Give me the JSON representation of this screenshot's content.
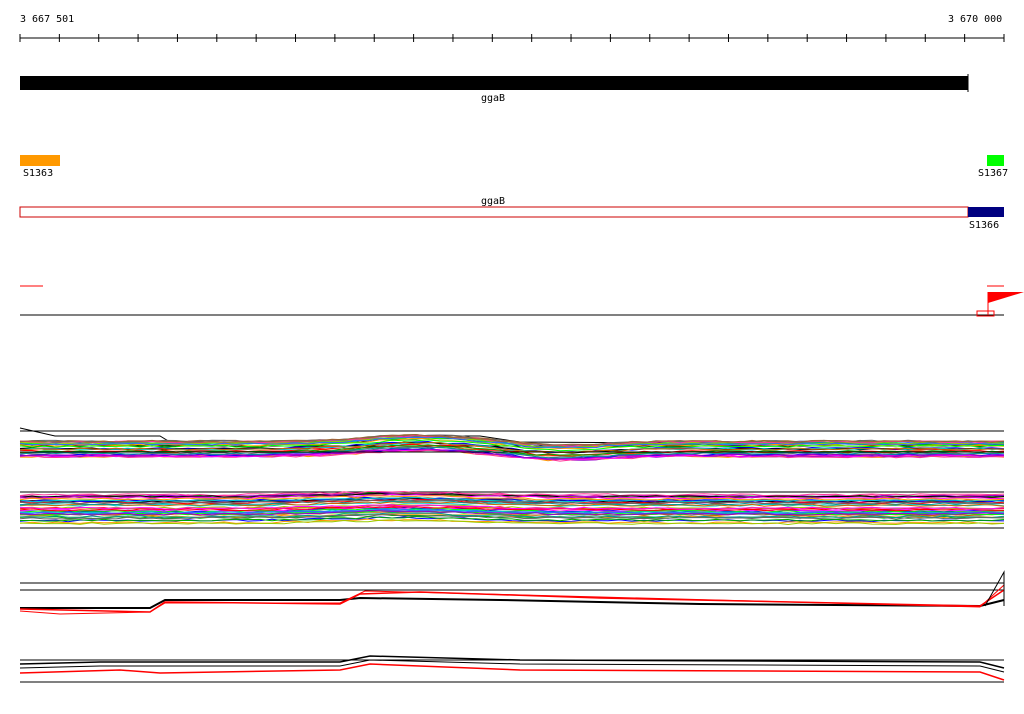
{
  "ruler": {
    "start_label": "3 667 501",
    "end_label": "3 670 000"
  },
  "genes": {
    "main_gene_label": "ggaB",
    "main_gene_color": "#000000",
    "transcript_label": "ggaB",
    "transcript_color": "#cc0000"
  },
  "features": [
    {
      "label": "S1363",
      "color": "#ff9900"
    },
    {
      "label": "S1367",
      "color": "#00ff00"
    },
    {
      "label": "S1366",
      "color": "#000080"
    }
  ],
  "signal_tracks": {
    "marker_color": "#ff0000",
    "flag_color": "#ff0000"
  },
  "colors": {
    "track_line": "#000000",
    "highlight_series": "#ff0000"
  }
}
